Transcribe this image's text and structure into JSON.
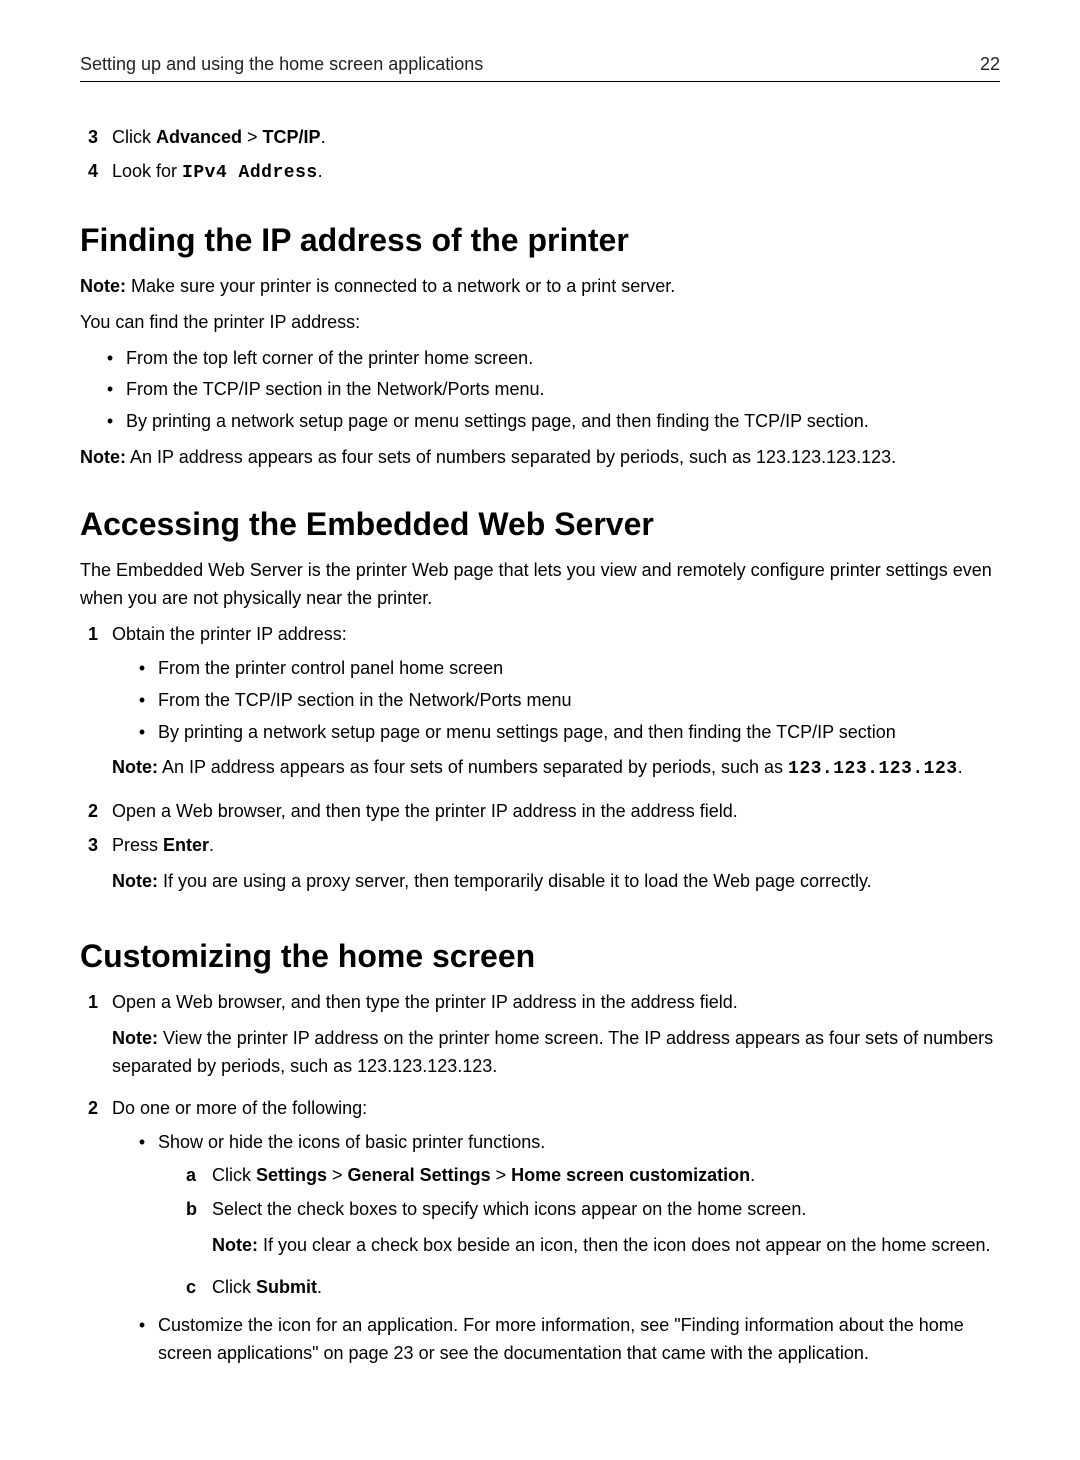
{
  "header": {
    "title": "Setting up and using the home screen applications",
    "page": "22"
  },
  "top_steps": {
    "s3_a": "Click ",
    "s3_b": "Advanced",
    "s3_c": " > ",
    "s3_d": "TCP/IP",
    "s3_e": ".",
    "s4_a": "Look for ",
    "s4_b": "IPv4 Address",
    "s4_c": "."
  },
  "finding": {
    "heading": "Finding the IP address of the printer",
    "note_label": "Note:",
    "note_text": " Make sure your printer is connected to a network or to a print server.",
    "lead": "You can find the printer IP address:",
    "b1": "From the top left corner of the printer home screen.",
    "b2": "From the TCP/IP section in the Network/Ports menu.",
    "b3": "By printing a network setup page or menu settings page, and then finding the TCP/IP section.",
    "note2_label": "Note:",
    "note2_text": " An IP address appears as four sets of numbers separated by periods, such as 123.123.123.123."
  },
  "accessing": {
    "heading": "Accessing the Embedded Web Server",
    "lead": "The Embedded Web Server is the printer Web page that lets you view and remotely configure printer settings even when you are not physically near the printer.",
    "s1": "Obtain the printer IP address:",
    "s1_b1": "From the printer control panel home screen",
    "s1_b2": "From the TCP/IP section in the Network/Ports menu",
    "s1_b3": "By printing a network setup page or menu settings page, and then finding the TCP/IP section",
    "s1_note_label": "Note:",
    "s1_note_text_a": " An IP address appears as four sets of numbers separated by periods, such as ",
    "s1_note_text_b": "123.123.123.123",
    "s1_note_text_c": ".",
    "s2": "Open a Web browser, and then type the printer IP address in the address field.",
    "s3_a": "Press ",
    "s3_b": "Enter",
    "s3_c": ".",
    "s3_note_label": "Note:",
    "s3_note_text": " If you are using a proxy server, then temporarily disable it to load the Web page correctly."
  },
  "customizing": {
    "heading": "Customizing the home screen",
    "s1": "Open a Web browser, and then type the printer IP address in the address field.",
    "s1_note_label": "Note:",
    "s1_note_text": " View the printer IP address on the printer home screen. The IP address appears as four sets of numbers separated by periods, such as 123.123.123.123.",
    "s2": "Do one or more of the following:",
    "s2_b1": "Show or hide the icons of basic printer functions.",
    "s2_b1_a_a": "Click ",
    "s2_b1_a_b": "Settings",
    "s2_b1_a_c": " > ",
    "s2_b1_a_d": "General Settings",
    "s2_b1_a_e": " > ",
    "s2_b1_a_f": "Home screen customization",
    "s2_b1_a_g": ".",
    "s2_b1_b": "Select the check boxes to specify which icons appear on the home screen.",
    "s2_b1_b_note_label": "Note:",
    "s2_b1_b_note_text": " If you clear a check box beside an icon, then the icon does not appear on the home screen.",
    "s2_b1_c_a": "Click ",
    "s2_b1_c_b": "Submit",
    "s2_b1_c_c": ".",
    "s2_b2": "Customize the icon for an application. For more information, see \"Finding information about the home screen applications\" on page 23 or see the documentation that came with the application."
  }
}
